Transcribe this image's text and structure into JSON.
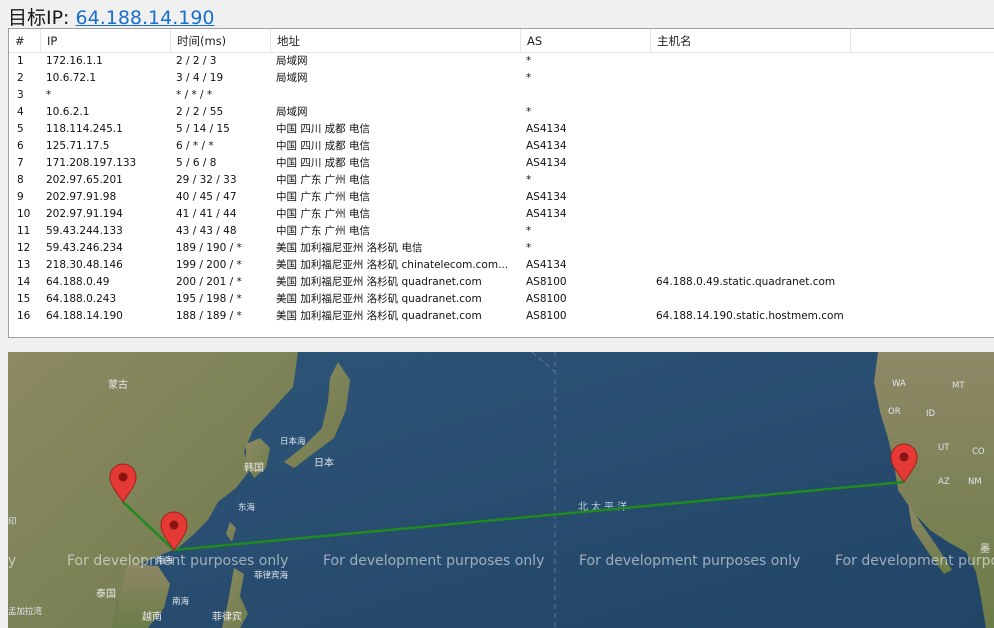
{
  "header": {
    "label": "目标IP:",
    "ip": "64.188.14.190"
  },
  "table": {
    "columns": [
      "#",
      "IP",
      "时间(ms)",
      "地址",
      "AS",
      "主机名"
    ],
    "rows": [
      [
        "1",
        "172.16.1.1",
        "2 / 2 / 3",
        "局域网",
        "*",
        ""
      ],
      [
        "2",
        "10.6.72.1",
        "3 / 4 / 19",
        "局域网",
        "*",
        ""
      ],
      [
        "3",
        "*",
        "* / * / *",
        "",
        "",
        ""
      ],
      [
        "4",
        "10.6.2.1",
        "2 / 2 / 55",
        "局域网",
        "*",
        ""
      ],
      [
        "5",
        "118.114.245.1",
        "5 / 14 / 15",
        "中国 四川 成都 电信",
        "AS4134",
        ""
      ],
      [
        "6",
        "125.71.17.5",
        "6 / * / *",
        "中国 四川 成都 电信",
        "AS4134",
        ""
      ],
      [
        "7",
        "171.208.197.133",
        "5 / 6 / 8",
        "中国 四川 成都 电信",
        "AS4134",
        ""
      ],
      [
        "8",
        "202.97.65.201",
        "29 / 32 / 33",
        "中国 广东 广州 电信",
        "*",
        ""
      ],
      [
        "9",
        "202.97.91.98",
        "40 / 45 / 47",
        "中国 广东 广州 电信",
        "AS4134",
        ""
      ],
      [
        "10",
        "202.97.91.194",
        "41 / 41 / 44",
        "中国 广东 广州 电信",
        "AS4134",
        ""
      ],
      [
        "11",
        "59.43.244.133",
        "43 / 43 / 48",
        "中国 广东 广州 电信",
        "*",
        ""
      ],
      [
        "12",
        "59.43.246.234",
        "189 / 190 / *",
        "美国 加利福尼亚州 洛杉矶 电信",
        "*",
        ""
      ],
      [
        "13",
        "218.30.48.146",
        "199 / 200 / *",
        "美国 加利福尼亚州 洛杉矶 chinatelecom.com...",
        "AS4134",
        ""
      ],
      [
        "14",
        "64.188.0.49",
        "200 / 201 / *",
        "美国 加利福尼亚州 洛杉矶 quadranet.com",
        "AS8100",
        "64.188.0.49.static.quadranet.com"
      ],
      [
        "15",
        "64.188.0.243",
        "195 / 198 / *",
        "美国 加利福尼亚州 洛杉矶 quadranet.com",
        "AS8100",
        ""
      ],
      [
        "16",
        "64.188.14.190",
        "188 / 189 / *",
        "美国 加利福尼亚州 洛杉矶 quadranet.com",
        "AS8100",
        "64.188.14.190.static.hostmem.com"
      ]
    ]
  },
  "map": {
    "watermark": "For development purposes only",
    "watermark_partial_left": "ly",
    "watermark_partial_right": "For development purpos",
    "route_color": "#1f8a1f",
    "pin_color": "#e53935",
    "labels": {
      "mongolia": "蒙古",
      "korea": "韩国",
      "japan": "日本",
      "sea_of_japan": "日本海",
      "east_sea": "东海",
      "south_sea": "南海",
      "south_sea2": "南海",
      "thailand": "泰国",
      "vietnam": "越南",
      "philippines": "菲律宾",
      "philippine_sea": "菲律宾海",
      "india_partial": "印",
      "bangladesh_partial": "孟加拉湾",
      "north_pacific": "北太平洋",
      "mexico_partial": "墨",
      "us_states": [
        "WA",
        "MT",
        "OR",
        "ID",
        "UT",
        "CO",
        "AZ",
        "NM"
      ]
    }
  }
}
